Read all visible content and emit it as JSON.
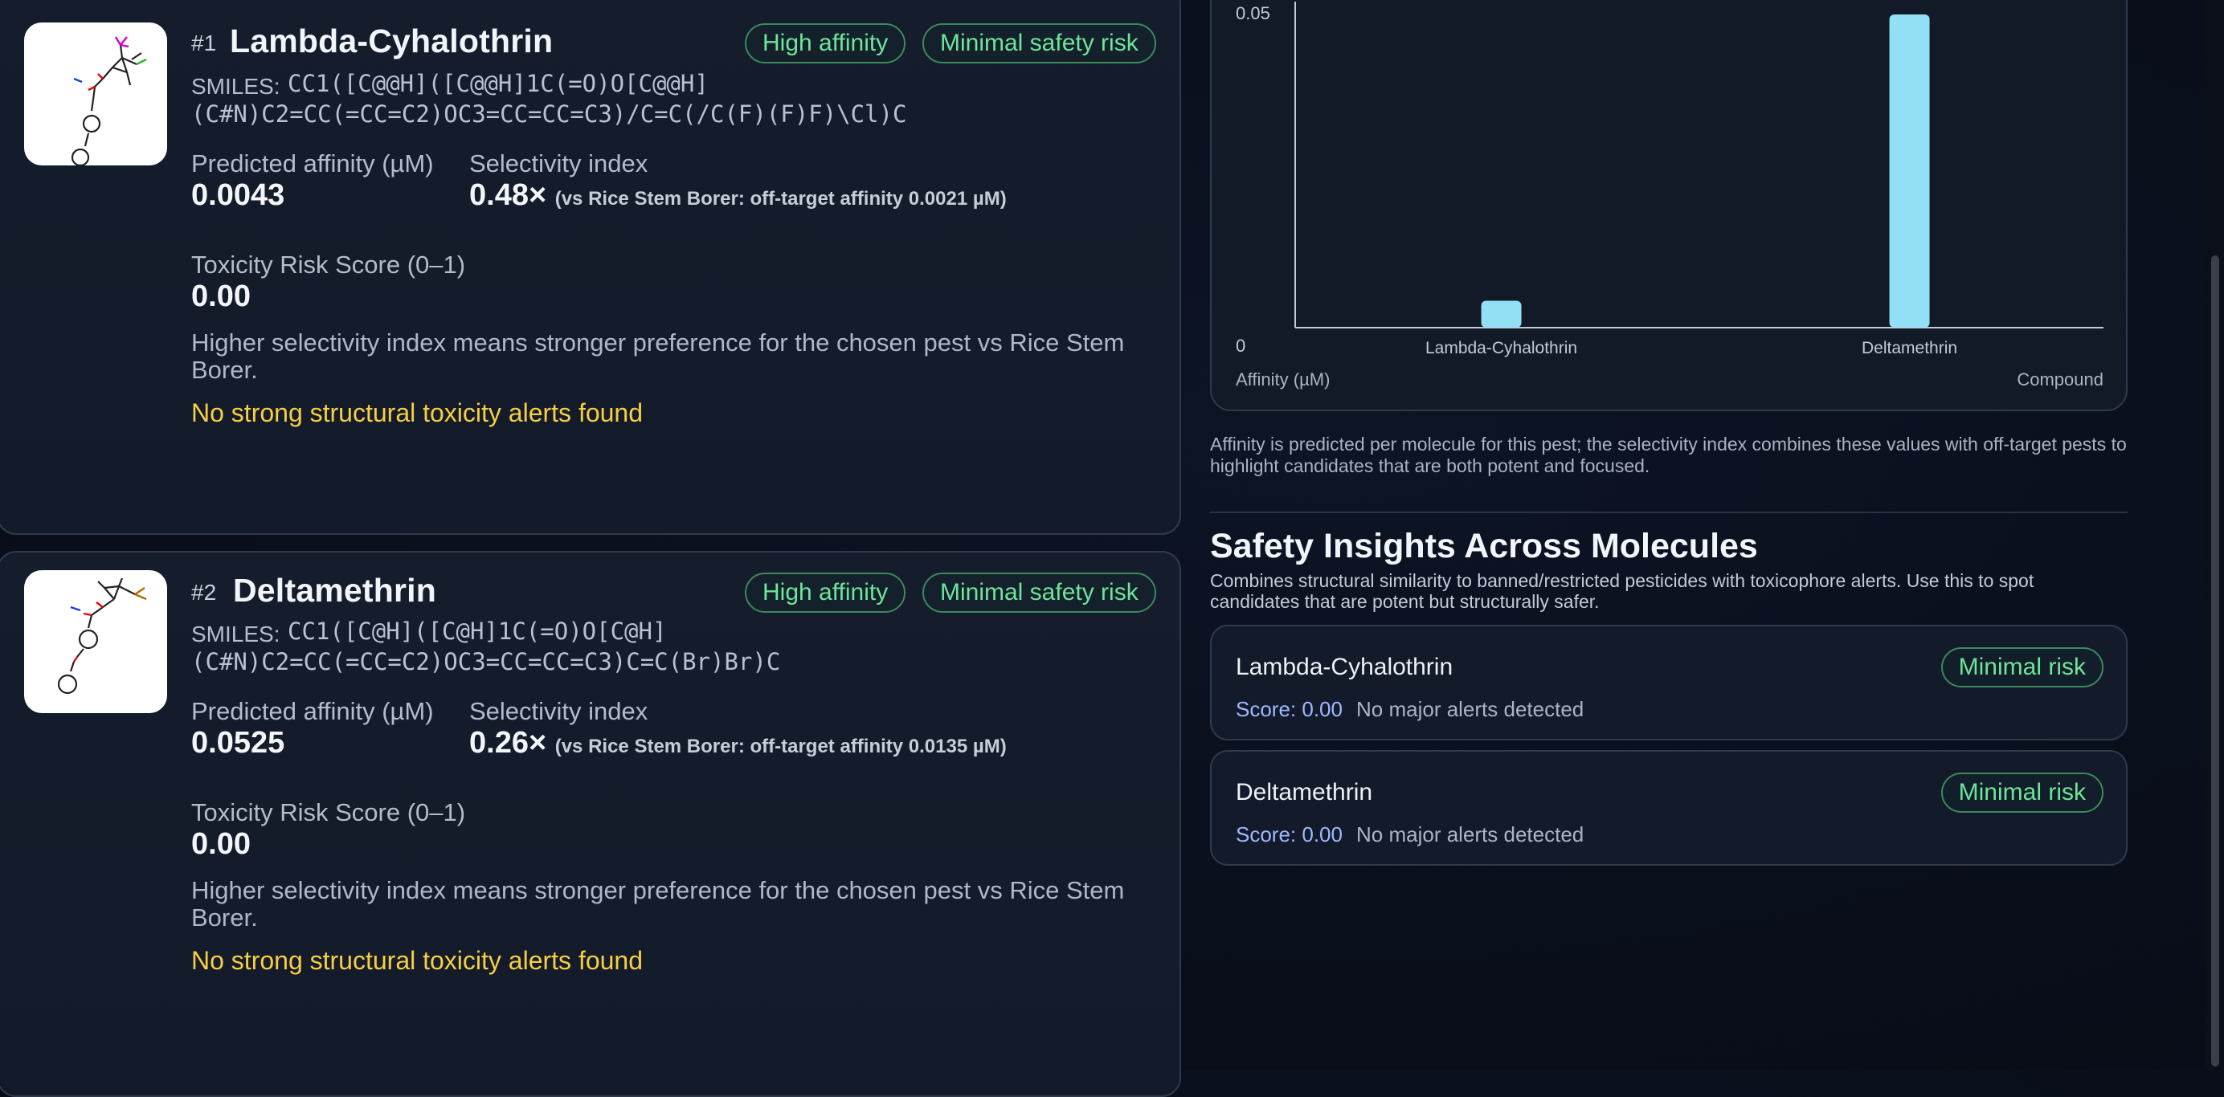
{
  "results": [
    {
      "rank": "#1",
      "name": "Lambda-Cyhalothrin",
      "badges": [
        "High affinity",
        "Minimal safety risk"
      ],
      "smiles_label": "SMILES:",
      "smiles_line1": "CC1([C@@H]([C@@H]1C(=O)O[C@@H]",
      "smiles_line2": "(C#N)C2=CC(=CC=C2)OC3=CC=CC=C3)/C=C(/C(F)(F)F)\\Cl)C",
      "affinity_label": "Predicted affinity (µM)",
      "affinity_value": "0.0043",
      "selectivity_label": "Selectivity index",
      "selectivity_value": "0.48×",
      "selectivity_note": "(vs Rice Stem Borer: off-target affinity 0.0021 µM)",
      "toxicity_label": "Toxicity Risk Score (0–1)",
      "toxicity_value": "0.00",
      "explanation": "Higher selectivity index means stronger preference for the chosen pest vs Rice Stem Borer.",
      "alert": "No strong structural toxicity alerts found"
    },
    {
      "rank": "#2",
      "name": "Deltamethrin",
      "badges": [
        "High affinity",
        "Minimal safety risk"
      ],
      "smiles_label": "SMILES:",
      "smiles_line1": "CC1([C@H]([C@H]1C(=O)O[C@H]",
      "smiles_line2": "(C#N)C2=CC(=CC=C2)OC3=CC=CC=C3)C=C(Br)Br)C",
      "affinity_label": "Predicted affinity (µM)",
      "affinity_value": "0.0525",
      "selectivity_label": "Selectivity index",
      "selectivity_value": "0.26×",
      "selectivity_note": "(vs Rice Stem Borer: off-target affinity 0.0135 µM)",
      "toxicity_label": "Toxicity Risk Score (0–1)",
      "toxicity_value": "0.00",
      "explanation": "Higher selectivity index means stronger preference for the chosen pest vs Rice Stem Borer.",
      "alert": "No strong structural toxicity alerts found"
    }
  ],
  "chart_data": {
    "type": "bar",
    "categories": [
      "Lambda-Cyhalothrin",
      "Deltamethrin"
    ],
    "values": [
      0.0043,
      0.0525
    ],
    "ylim": [
      0,
      0.05
    ],
    "yticks": [
      "0.05",
      "0"
    ],
    "ylabel": "Affinity (µM)",
    "xlabel": "Compound",
    "bar_color": "#93dff5",
    "grid": false
  },
  "chart_caption": "Affinity is predicted per molecule for this pest; the selectivity index combines these values with off-target pests to highlight candidates that are both potent and focused.",
  "safety": {
    "title": "Safety Insights Across Molecules",
    "subtitle": "Combines structural similarity to banned/restricted pesticides with toxicophore alerts. Use this to spot candidates that are potent but structurally safer.",
    "items": [
      {
        "name": "Lambda-Cyhalothrin",
        "badge": "Minimal risk",
        "score": "Score: 0.00",
        "note": "No major alerts detected"
      },
      {
        "name": "Deltamethrin",
        "badge": "Minimal risk",
        "score": "Score: 0.00",
        "note": "No major alerts detected"
      }
    ]
  },
  "colors": {
    "background": "#0a0f1c",
    "card": "#141c2b",
    "accent_green": "#6ee59a",
    "alert_yellow": "#f7cf42",
    "bar": "#93dff5",
    "score_blue": "#9fb8ff"
  }
}
